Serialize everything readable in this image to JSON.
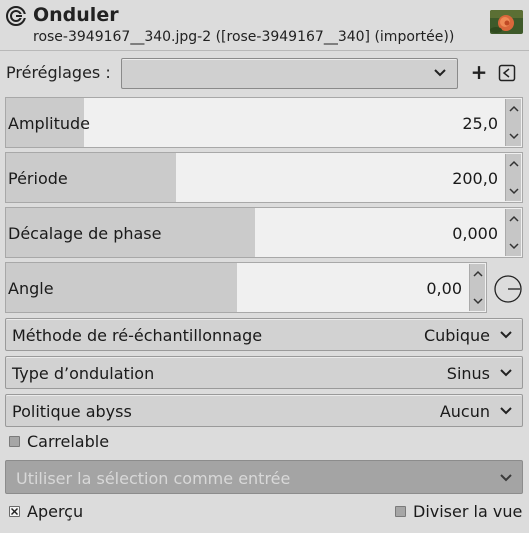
{
  "header": {
    "title": "Onduler",
    "subtitle": "rose-3949167__340.jpg-2 ([rose-3949167__340] (importée))",
    "icon": "gimp-wilber-icon",
    "thumbnail": "rose-image-thumbnail"
  },
  "presets": {
    "label": "Préréglages :",
    "value": "",
    "add_icon": "plus-icon",
    "add_label": "+",
    "menu_icon": "preset-menu-icon"
  },
  "params": [
    {
      "label": "Amplitude",
      "value": "25,0",
      "fill_fraction": 0.15
    },
    {
      "label": "Période",
      "value": "200,0",
      "fill_fraction": 0.33
    },
    {
      "label": "Décalage de phase",
      "value": "0,000",
      "fill_fraction": 0.48
    },
    {
      "label": "Angle",
      "value": "0,00",
      "fill_fraction": 0.48
    }
  ],
  "combos": [
    {
      "label": "Méthode de ré-échantillonnage",
      "value": "Cubique"
    },
    {
      "label": "Type d’ondulation",
      "value": "Sinus"
    },
    {
      "label": "Politique abyss",
      "value": "Aucun"
    }
  ],
  "tileable": {
    "label": "Carrelable",
    "checked": false
  },
  "input_selection": {
    "label": "Utiliser la sélection comme entrée",
    "enabled": false
  },
  "preview": {
    "label": "Aperçu",
    "checked": true
  },
  "split_view": {
    "label": "Diviser la vue",
    "checked": false
  },
  "colors": {
    "background": "#dcdcdc",
    "slider_fill": "#cbcbcb",
    "slider_bg": "#f0f0f0",
    "disabled_button": "#a4a4a4"
  }
}
